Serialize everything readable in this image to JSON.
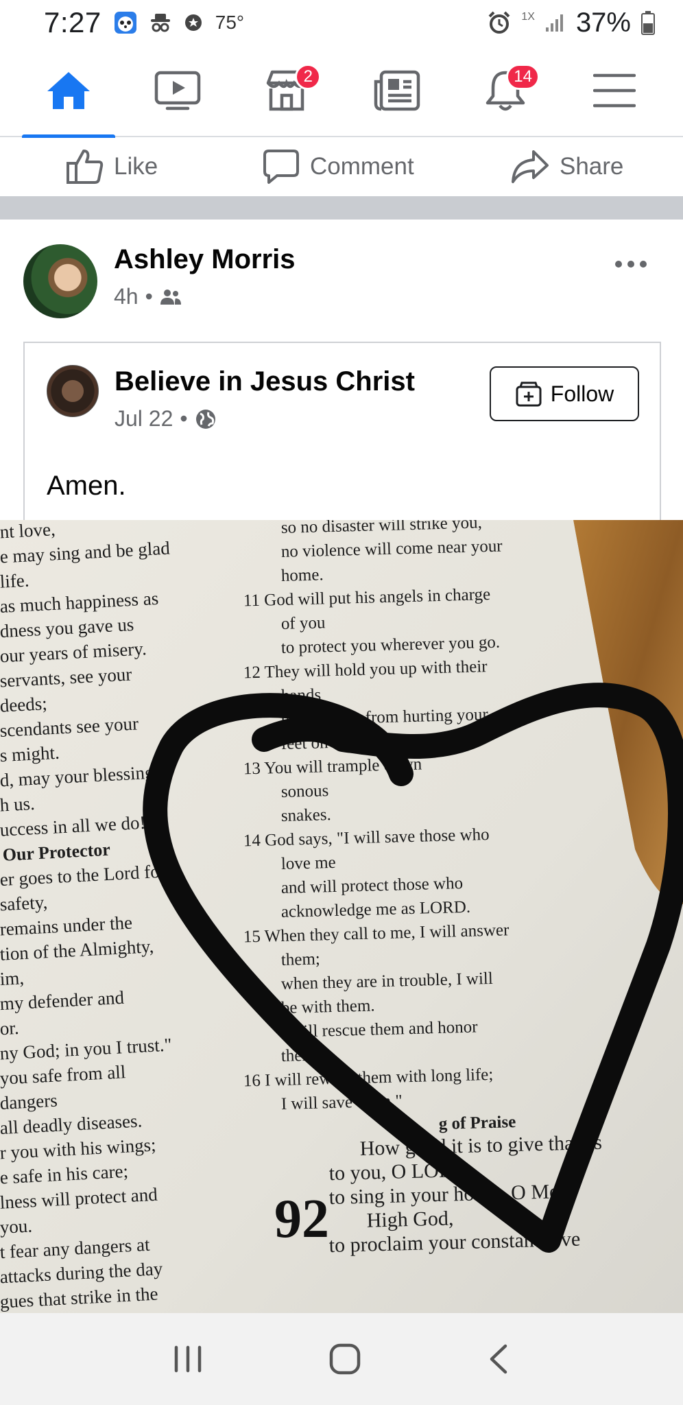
{
  "status_bar": {
    "time": "7:27",
    "temperature": "75°",
    "network_label": "1X",
    "battery_percent": "37%"
  },
  "nav": {
    "items": [
      {
        "name": "home",
        "icon": "home-icon",
        "active": true
      },
      {
        "name": "watch",
        "icon": "video-icon"
      },
      {
        "name": "marketplace",
        "icon": "marketplace-icon",
        "badge": "2"
      },
      {
        "name": "news",
        "icon": "news-icon"
      },
      {
        "name": "notifications",
        "icon": "bell-icon",
        "badge": "14"
      },
      {
        "name": "menu",
        "icon": "hamburger-icon"
      }
    ],
    "accent_color": "#1877f2",
    "badge_color": "#f02849"
  },
  "actions": {
    "like": "Like",
    "comment": "Comment",
    "share": "Share"
  },
  "post": {
    "author": "Ashley Morris",
    "time": "4h",
    "audience_icon": "friends-icon",
    "more_icon": "more-icon",
    "shared": {
      "page_name": "Believe in Jesus Christ",
      "date": "Jul 22",
      "audience_icon": "globe-icon",
      "follow_label": "Follow",
      "text": "Amen."
    }
  },
  "photo": {
    "left_column": [
      "nt love,",
      "e may sing and be glad",
      "life.",
      "as much happiness as",
      "dness you gave us",
      "our years of misery.",
      "servants, see your",
      "deeds;",
      "scendants see your",
      "s might.",
      "d, may your blessings",
      "h us.",
      "uccess in all we do!",
      "Our Protector",
      "er goes to the Lord for",
      "safety,",
      "remains under the",
      "tion of the Almighty,",
      "im,",
      "my defender and",
      "or.",
      "ny God; in you I trust.\"",
      "you safe from all",
      "dangers",
      "all deadly diseases.",
      "r you with his wings;",
      "e safe in his care;",
      "lness will protect and",
      "you.",
      "t fear any dangers at",
      "attacks during the day",
      "gues that strike in the"
    ],
    "right_column": [
      "so no disaster will strike you,",
      "no violence will come near your",
      "home.",
      "11 God will put his angels in charge",
      "of you",
      "to protect you wherever you go.",
      "12 They will hold you up with their",
      "hands",
      "to keep you from hurting your",
      "feet on the stones.",
      "13 You will trample down",
      "sonous",
      "snakes.",
      "14 God says, \"I will save those who",
      "love me",
      "and will protect those who",
      "acknowledge me as LORD.",
      "15 When they call to me, I will answer",
      "them;",
      "when they are in trouble, I will",
      "be with them.",
      "I will rescue them and honor",
      "them.",
      "16 I will reward them with long life;",
      "I will save them.\"",
      "g of Praise",
      "How good it is to give thanks",
      "to you, O LORD,",
      "to sing in your honor, O Most",
      "High God,",
      "to proclaim your constant love"
    ],
    "psalm_number": "92"
  }
}
